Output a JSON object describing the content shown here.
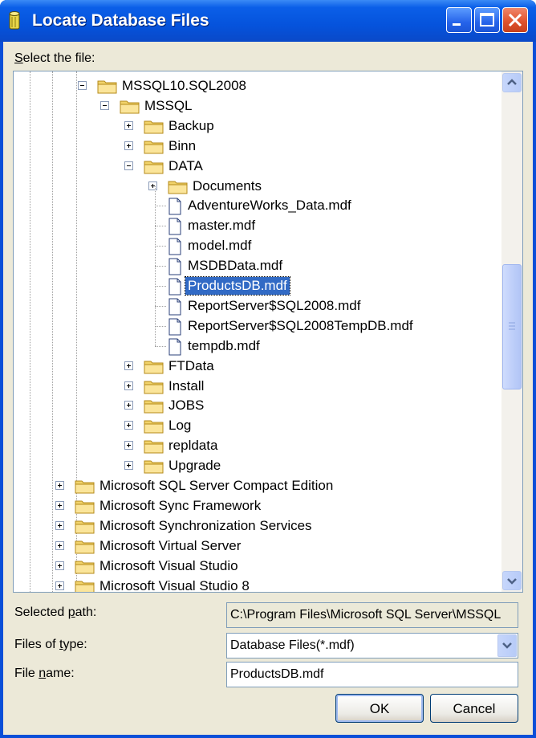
{
  "window": {
    "title": "Locate Database Files"
  },
  "select_label_prefix": "S",
  "select_label_rest": "elect the file:",
  "tree": {
    "nodes": [
      {
        "label": "MSSQL10.SQL2008",
        "kind": "folder",
        "expander": "minus"
      },
      {
        "label": "MSSQL",
        "kind": "folder",
        "expander": "minus"
      },
      {
        "label": "Backup",
        "kind": "folder",
        "expander": "plus"
      },
      {
        "label": "Binn",
        "kind": "folder",
        "expander": "plus"
      },
      {
        "label": "DATA",
        "kind": "folder",
        "expander": "minus"
      },
      {
        "label": "Documents",
        "kind": "folder",
        "expander": "plus"
      },
      {
        "label": "AdventureWorks_Data.mdf",
        "kind": "file"
      },
      {
        "label": "master.mdf",
        "kind": "file"
      },
      {
        "label": "model.mdf",
        "kind": "file"
      },
      {
        "label": "MSDBData.mdf",
        "kind": "file"
      },
      {
        "label": "ProductsDB.mdf",
        "kind": "file",
        "selected": true
      },
      {
        "label": "ReportServer$SQL2008.mdf",
        "kind": "file"
      },
      {
        "label": "ReportServer$SQL2008TempDB.mdf",
        "kind": "file"
      },
      {
        "label": "tempdb.mdf",
        "kind": "file"
      },
      {
        "label": "FTData",
        "kind": "folder",
        "expander": "plus"
      },
      {
        "label": "Install",
        "kind": "folder",
        "expander": "plus"
      },
      {
        "label": "JOBS",
        "kind": "folder",
        "expander": "plus"
      },
      {
        "label": "Log",
        "kind": "folder",
        "expander": "plus"
      },
      {
        "label": "repldata",
        "kind": "folder",
        "expander": "plus"
      },
      {
        "label": "Upgrade",
        "kind": "folder",
        "expander": "plus"
      },
      {
        "label": "Microsoft SQL Server Compact Edition",
        "kind": "folder",
        "expander": "plus"
      },
      {
        "label": "Microsoft Sync Framework",
        "kind": "folder",
        "expander": "plus"
      },
      {
        "label": "Microsoft Synchronization Services",
        "kind": "folder",
        "expander": "plus"
      },
      {
        "label": "Microsoft Virtual Server",
        "kind": "folder",
        "expander": "plus"
      },
      {
        "label": "Microsoft Visual Studio",
        "kind": "folder",
        "expander": "plus"
      },
      {
        "label": "Microsoft Visual Studio 8",
        "kind": "folder",
        "expander": "plus"
      }
    ]
  },
  "selected_path": {
    "label_pre": "Selected ",
    "label_u": "p",
    "label_post": "ath:",
    "value": "C:\\Program Files\\Microsoft SQL Server\\MSSQL"
  },
  "files_of_type": {
    "label_pre": "Files of ",
    "label_u": "t",
    "label_post": "ype:",
    "value": "Database Files(*.mdf)"
  },
  "file_name": {
    "label_pre": "File ",
    "label_u": "n",
    "label_post": "ame:",
    "value": "ProductsDB.mdf"
  },
  "buttons": {
    "ok": "OK",
    "cancel": "Cancel"
  },
  "colors": {
    "titlebar": "#0553dc",
    "selection": "#316ac5",
    "dialog_bg": "#ece9d8"
  },
  "icons": [
    "database-icon",
    "minimize-icon",
    "maximize-icon",
    "close-icon",
    "folder-icon",
    "file-icon",
    "scroll-up-icon",
    "scroll-down-icon",
    "dropdown-arrow-icon"
  ]
}
